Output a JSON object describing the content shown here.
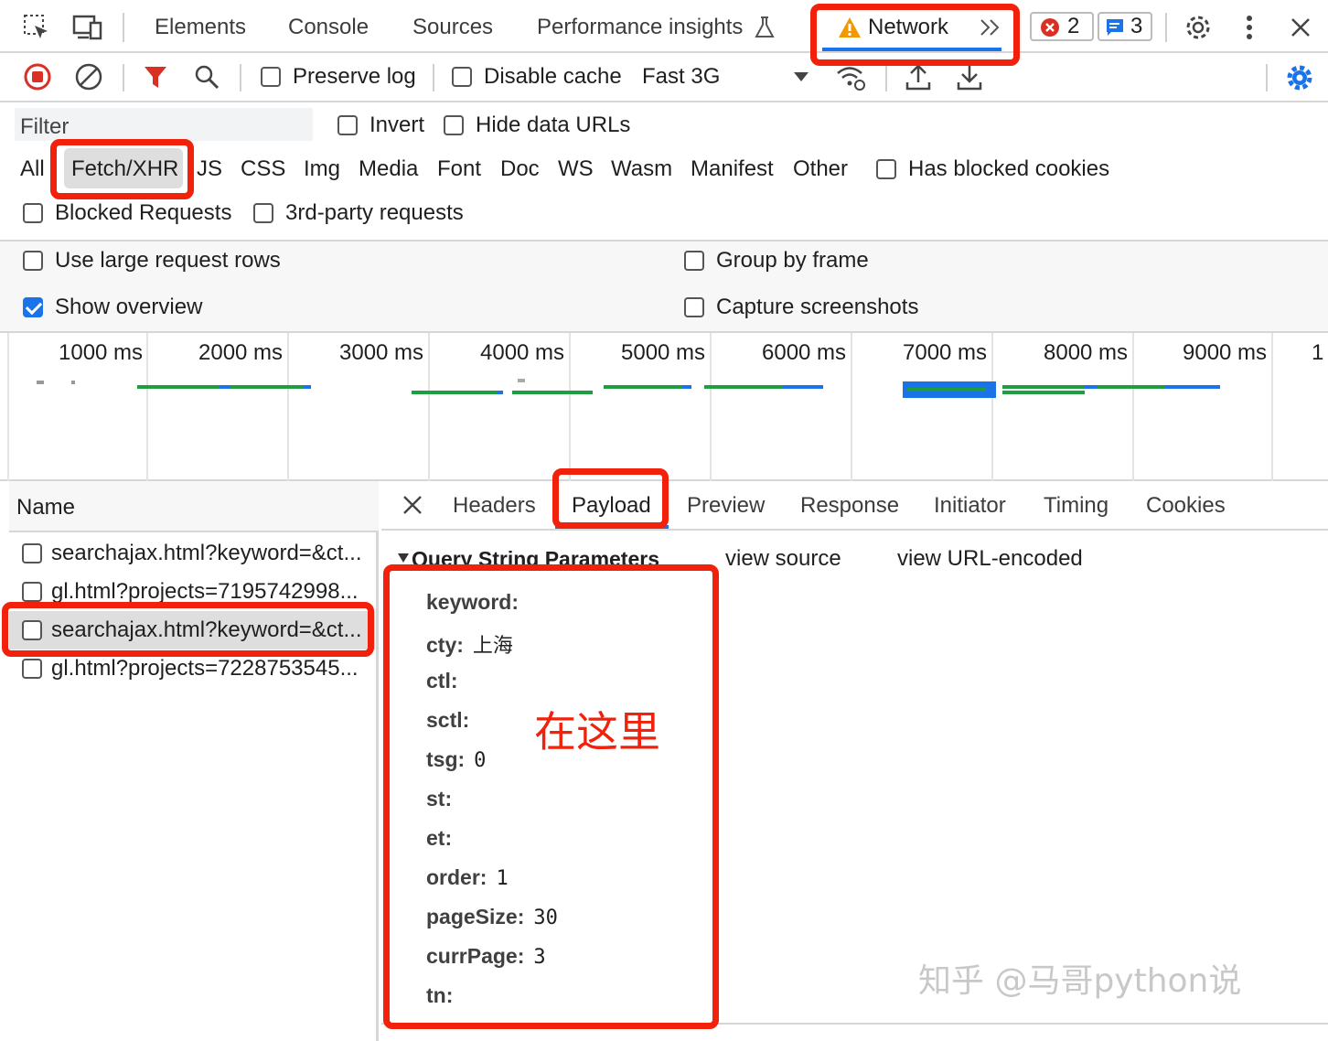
{
  "tabs": {
    "elements": "Elements",
    "console": "Console",
    "sources": "Sources",
    "performance": "Performance insights",
    "network": "Network",
    "error_count": "2",
    "message_count": "3"
  },
  "toolbar": {
    "preserve_log": "Preserve log",
    "disable_cache": "Disable cache",
    "throttle": "Fast 3G"
  },
  "filter": {
    "placeholder": "Filter",
    "invert": "Invert",
    "hide_data_urls": "Hide data URLs",
    "types": [
      "All",
      "Fetch/XHR",
      "JS",
      "CSS",
      "Img",
      "Media",
      "Font",
      "Doc",
      "WS",
      "Wasm",
      "Manifest",
      "Other"
    ],
    "has_blocked_cookies": "Has blocked cookies",
    "blocked_requests": "Blocked Requests",
    "third_party": "3rd-party requests"
  },
  "settings": {
    "large_rows": "Use large request rows",
    "group_by_frame": "Group by frame",
    "show_overview": "Show overview",
    "capture_screenshots": "Capture screenshots"
  },
  "overview": {
    "ticks": [
      "1000 ms",
      "2000 ms",
      "3000 ms",
      "4000 ms",
      "5000 ms",
      "6000 ms",
      "7000 ms",
      "8000 ms",
      "9000 ms",
      "1"
    ]
  },
  "requests": {
    "header": "Name",
    "items": [
      "searchajax.html?keyword=&ct...",
      "gl.html?projects=7195742998...",
      "searchajax.html?keyword=&ct...",
      "gl.html?projects=7228753545..."
    ]
  },
  "detail": {
    "tabs": [
      "Headers",
      "Payload",
      "Preview",
      "Response",
      "Initiator",
      "Timing",
      "Cookies"
    ],
    "section_title": "Query String Parameters",
    "view_source": "view source",
    "view_url_encoded": "view URL-encoded",
    "params": [
      {
        "key": "keyword:",
        "value": ""
      },
      {
        "key": "cty:",
        "value": "上海"
      },
      {
        "key": "ctl:",
        "value": ""
      },
      {
        "key": "sctl:",
        "value": ""
      },
      {
        "key": "tsg:",
        "value": "0"
      },
      {
        "key": "st:",
        "value": ""
      },
      {
        "key": "et:",
        "value": ""
      },
      {
        "key": "order:",
        "value": "1"
      },
      {
        "key": "pageSize:",
        "value": "30"
      },
      {
        "key": "currPage:",
        "value": "3"
      },
      {
        "key": "tn:",
        "value": ""
      }
    ]
  },
  "annotation": {
    "here_text": "在这里",
    "watermark": "知乎 @马哥python说"
  },
  "colors": {
    "highlight": "#f2210b",
    "accent": "#1a73e8",
    "warning": "#f29900",
    "waterfall_green": "#1e9e3e",
    "waterfall_blue": "#1a73e8"
  }
}
